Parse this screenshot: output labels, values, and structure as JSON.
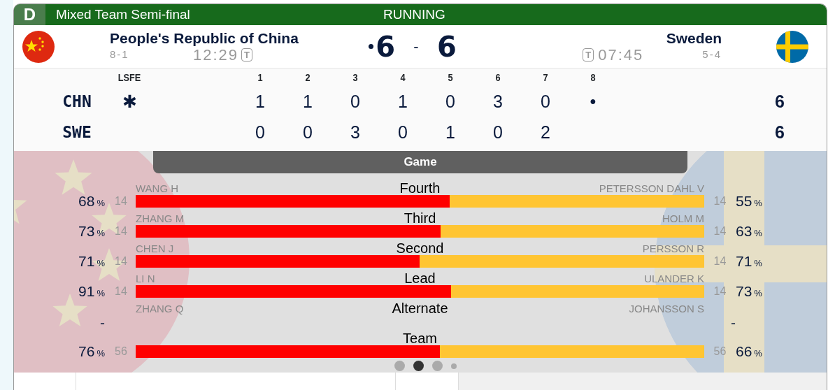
{
  "header": {
    "badge": "D",
    "title": "Mixed Team Semi-final",
    "status": "RUNNING"
  },
  "teams": [
    {
      "name": "People's Republic of China",
      "record": "8-1",
      "time": "12:29",
      "timeout": "T",
      "score": "6",
      "hammer": true
    },
    {
      "name": "Sweden",
      "record": "5-4",
      "time": "07:45",
      "timeout": "T",
      "score": "6",
      "hammer": false
    }
  ],
  "score_separator": "-",
  "line_score": {
    "columns": [
      "LSFE",
      "1",
      "2",
      "3",
      "4",
      "5",
      "6",
      "7",
      "8"
    ],
    "rows": [
      {
        "team": "CHN",
        "lsfe": "✱",
        "ends": [
          "1",
          "1",
          "0",
          "1",
          "0",
          "3",
          "0",
          "•"
        ],
        "total": "6"
      },
      {
        "team": "SWE",
        "ends": [
          "0",
          "0",
          "3",
          "0",
          "1",
          "0",
          "2"
        ],
        "total": "6"
      }
    ]
  },
  "game": {
    "title": "Game",
    "rows": [
      {
        "kind": "player",
        "position": "Fourth",
        "level": 0.552,
        "home": {
          "name": "WANG H",
          "value": "68",
          "unit": "%",
          "count": "14"
        },
        "away": {
          "name": "PETERSSON DAHL V",
          "value": "55",
          "unit": "%",
          "count": "14"
        }
      },
      {
        "kind": "player",
        "position": "Third",
        "level": 0.536,
        "home": {
          "name": "ZHANG M",
          "value": "73",
          "unit": "%",
          "count": "14"
        },
        "away": {
          "name": "HOLM M",
          "value": "63",
          "unit": "%",
          "count": "14"
        }
      },
      {
        "kind": "player",
        "position": "Second",
        "level": 0.499,
        "home": {
          "name": "CHEN J",
          "value": "71",
          "unit": "%",
          "count": "14"
        },
        "away": {
          "name": "PERSSON R",
          "value": "71",
          "unit": "%",
          "count": "14"
        }
      },
      {
        "kind": "player",
        "position": "Lead",
        "level": 0.555,
        "home": {
          "name": "LI N",
          "value": "91",
          "unit": "%",
          "count": "14"
        },
        "away": {
          "name": "ULANDER K",
          "value": "73",
          "unit": "%",
          "count": "14"
        }
      },
      {
        "kind": "alternate",
        "position": "Alternate",
        "home": {
          "name": "ZHANG Q",
          "value": "-"
        },
        "away": {
          "name": "JOHANSSON S",
          "value": "-"
        }
      },
      {
        "kind": "team",
        "position": "Team",
        "level": 0.535,
        "home": {
          "value": "76",
          "unit": "%",
          "count": "56"
        },
        "away": {
          "value": "66",
          "unit": "%",
          "count": "56"
        }
      }
    ]
  },
  "pager": [
    {
      "kind": "page",
      "selected": false
    },
    {
      "kind": "page",
      "selected": true
    },
    {
      "kind": "page",
      "selected": false
    },
    {
      "kind": "more",
      "selected": false
    }
  ]
}
